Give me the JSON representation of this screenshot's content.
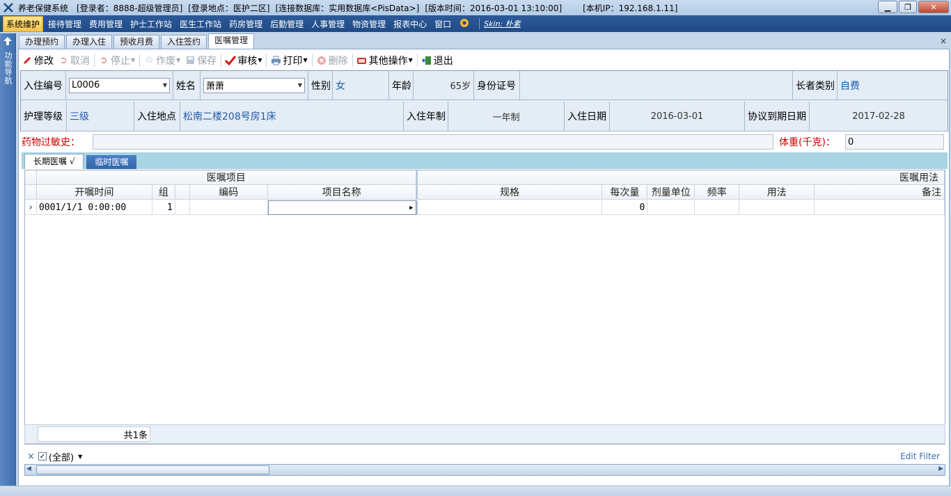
{
  "titlebar": {
    "app_name": "养老保健系统",
    "login_user": "[登录者：8888-超级管理员]",
    "login_location": "[登录地点：医护二区]",
    "database": "[连接数据库：实用数据库<PisData>]",
    "version_time": "[版本时间：2016-03-01 13:10:00]",
    "local_ip": "[本机IP：192.168.1.11]"
  },
  "menubar": {
    "items": [
      "系统维护",
      "接待管理",
      "费用管理",
      "护士工作站",
      "医生工作站",
      "药房管理",
      "后勤管理",
      "人事管理",
      "物资管理",
      "报表中心",
      "窗口"
    ],
    "active_index": 0,
    "skin_label": "Skin: 朴素"
  },
  "sidebar": {
    "label": "功能导航"
  },
  "doc_tabs": {
    "items": [
      "办理预约",
      "办理入住",
      "预收月费",
      "入住签约",
      "医嘱管理"
    ],
    "active_index": 4,
    "close_glyph": "×"
  },
  "toolbar": {
    "modify": "修改",
    "cancel": "取消",
    "stop": "停止",
    "void": "作废",
    "save": "保存",
    "audit": "审核",
    "print": "打印",
    "delete": "删除",
    "other": "其他操作",
    "exit": "退出"
  },
  "resident": {
    "id_label": "入住编号",
    "id_value": "L0006",
    "name_label": "姓名",
    "name_value": "萧萧",
    "gender_label": "性别",
    "gender_value": "女",
    "age_label": "年龄",
    "age_value": "65岁",
    "idcard_label": "身份证号",
    "idcard_value": "",
    "type_label": "长者类别",
    "type_value": "自费",
    "care_label": "护理等级",
    "care_value": "三级",
    "location_label": "入住地点",
    "location_value": "松南二楼208号房1床",
    "term_label": "入住年制",
    "term_value": "一年制",
    "date_label": "入住日期",
    "date_value": "2016-03-01",
    "expire_label": "协议到期日期",
    "expire_value": "2017-02-28"
  },
  "allergy": {
    "label": "药物过敏史：",
    "value": "",
    "weight_label": "体重(千克)：",
    "weight_value": "0"
  },
  "order_tabs": {
    "long_term": "长期医嘱  √",
    "temporary": "临时医嘱"
  },
  "grid": {
    "band_items": "医嘱项目",
    "band_usage": "医嘱用法",
    "columns": [
      "开嘱时间",
      "组",
      "",
      "编码",
      "项目名称",
      "规格",
      "每次量",
      "剂量单位",
      "频率",
      "用法",
      "备注"
    ],
    "rows": [
      {
        "time": "0001/1/1 0:00:00",
        "group": "1",
        "flag": "",
        "code": "",
        "name": "",
        "spec": "",
        "dose": "0",
        "unit": "",
        "freq": "",
        "usage": "",
        "remark": ""
      }
    ],
    "row_indicator": "›"
  },
  "footer": {
    "count": "共1条",
    "filter_close": "×",
    "filter_text": "(全部)",
    "edit_filter": "Edit Filter"
  },
  "colors": {
    "menubar": "#1f4a86",
    "accent_red": "#cc0000",
    "value_blue": "#1f5aa8"
  }
}
